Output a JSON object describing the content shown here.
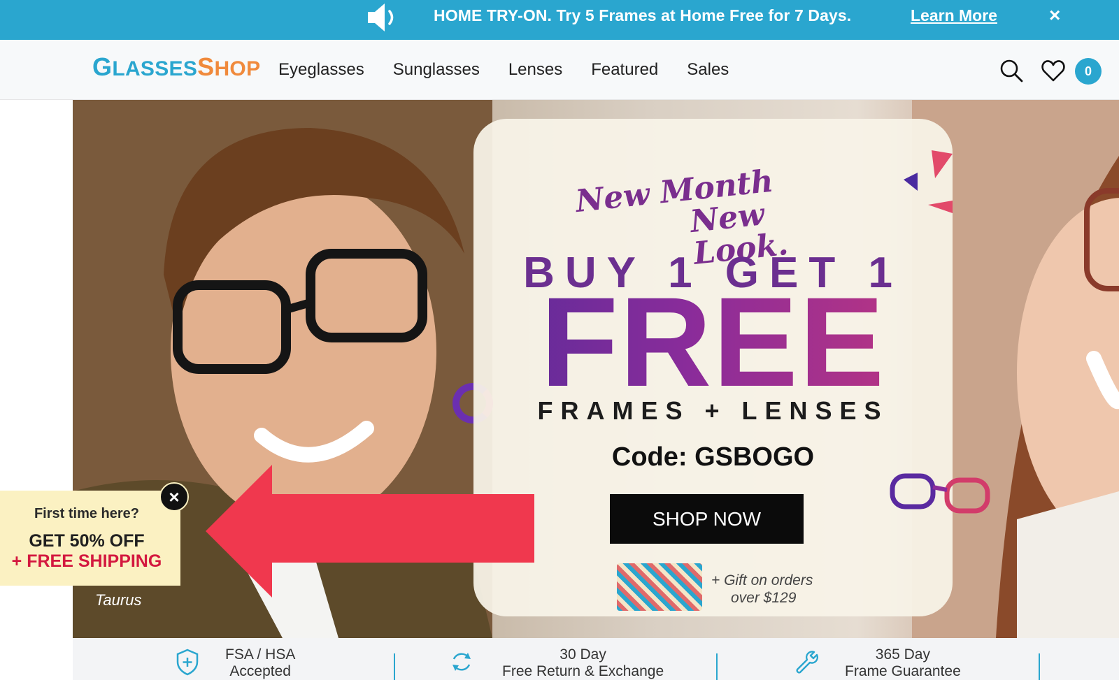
{
  "announcement": {
    "message": "HOME TRY-ON. Try 5 Frames at Home Free for 7 Days.",
    "link_label": "Learn More",
    "close_label": "×",
    "icon": "speaker-icon"
  },
  "header": {
    "logo": {
      "first_initial": "G",
      "first_rest": "LASSES",
      "second_initial": "S",
      "second_rest": "HOP"
    },
    "nav": [
      {
        "label": "Eyeglasses"
      },
      {
        "label": "Sunglasses"
      },
      {
        "label": "Lenses"
      },
      {
        "label": "Featured"
      },
      {
        "label": "Sales"
      }
    ],
    "icons": [
      "search-icon",
      "heart-icon"
    ],
    "cart_count": "0"
  },
  "hero": {
    "tagline_line1": "New Month",
    "tagline_line2": "New Look.",
    "headline_top": "BUY 1 GET 1",
    "headline_main": "FREE",
    "headline_sub": "FRAMES + LENSES",
    "code": "Code: GSBOGO",
    "cta_label": "SHOP NOW",
    "gift_line1": "+ Gift on orders",
    "gift_line2": "over $129",
    "model_name": "Taurus"
  },
  "popup": {
    "question": "First time here?",
    "offer": "GET 50% OFF",
    "shipping": "+ FREE SHIPPING",
    "close_label": "×"
  },
  "benefits": [
    {
      "icon": "shield-plus-icon",
      "line1": "FSA / HSA",
      "line2": "Accepted"
    },
    {
      "icon": "refresh-icon",
      "line1": "30 Day",
      "line2": "Free Return & Exchange"
    },
    {
      "icon": "wrench-icon",
      "line1": "365 Day",
      "line2": "Frame Guarantee"
    }
  ],
  "colors": {
    "brand_blue": "#2aa6cf",
    "brand_orange": "#f08a3c",
    "promo_purple": "#6b2f90",
    "promo_magenta": "#c0367f",
    "arrow_red": "#f0384e",
    "popup_bg": "#fbf1c2"
  }
}
